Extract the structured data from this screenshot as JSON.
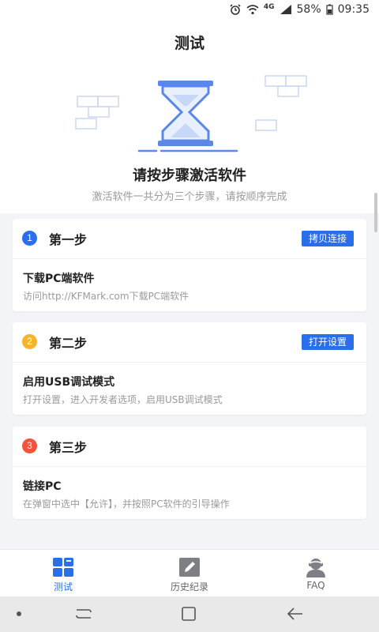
{
  "status_bar": {
    "network": "4G",
    "battery": "58%",
    "time": "09:35"
  },
  "header": {
    "title": "测试",
    "hero_title": "请按步骤激活软件",
    "hero_subtitle": "激活软件一共分为三个步骤，请按顺序完成"
  },
  "steps": [
    {
      "number": "1",
      "title": "第一步",
      "button": "拷贝连接",
      "item_title": "下载PC端软件",
      "item_desc": "访问http://KFMark.com下载PC端软件",
      "color": "#2a6ee9"
    },
    {
      "number": "2",
      "title": "第二步",
      "button": "打开设置",
      "item_title": "启用USB调试模式",
      "item_desc": "打开设置，进入开发者选项，启用USB调试模式",
      "color": "#f5b42a"
    },
    {
      "number": "3",
      "title": "第三步",
      "item_title": "链接PC",
      "item_desc": "在弹窗中选中【允许】，并按照PC软件的引导操作",
      "color": "#f0543a"
    }
  ],
  "bottom_nav": [
    {
      "label": "测试",
      "icon": "grid-icon",
      "active": true
    },
    {
      "label": "历史纪录",
      "icon": "pencil-icon",
      "active": false
    },
    {
      "label": "FAQ",
      "icon": "support-agent-icon",
      "active": false
    }
  ],
  "colors": {
    "accent": "#2a6ee9",
    "inactive": "#777777"
  }
}
